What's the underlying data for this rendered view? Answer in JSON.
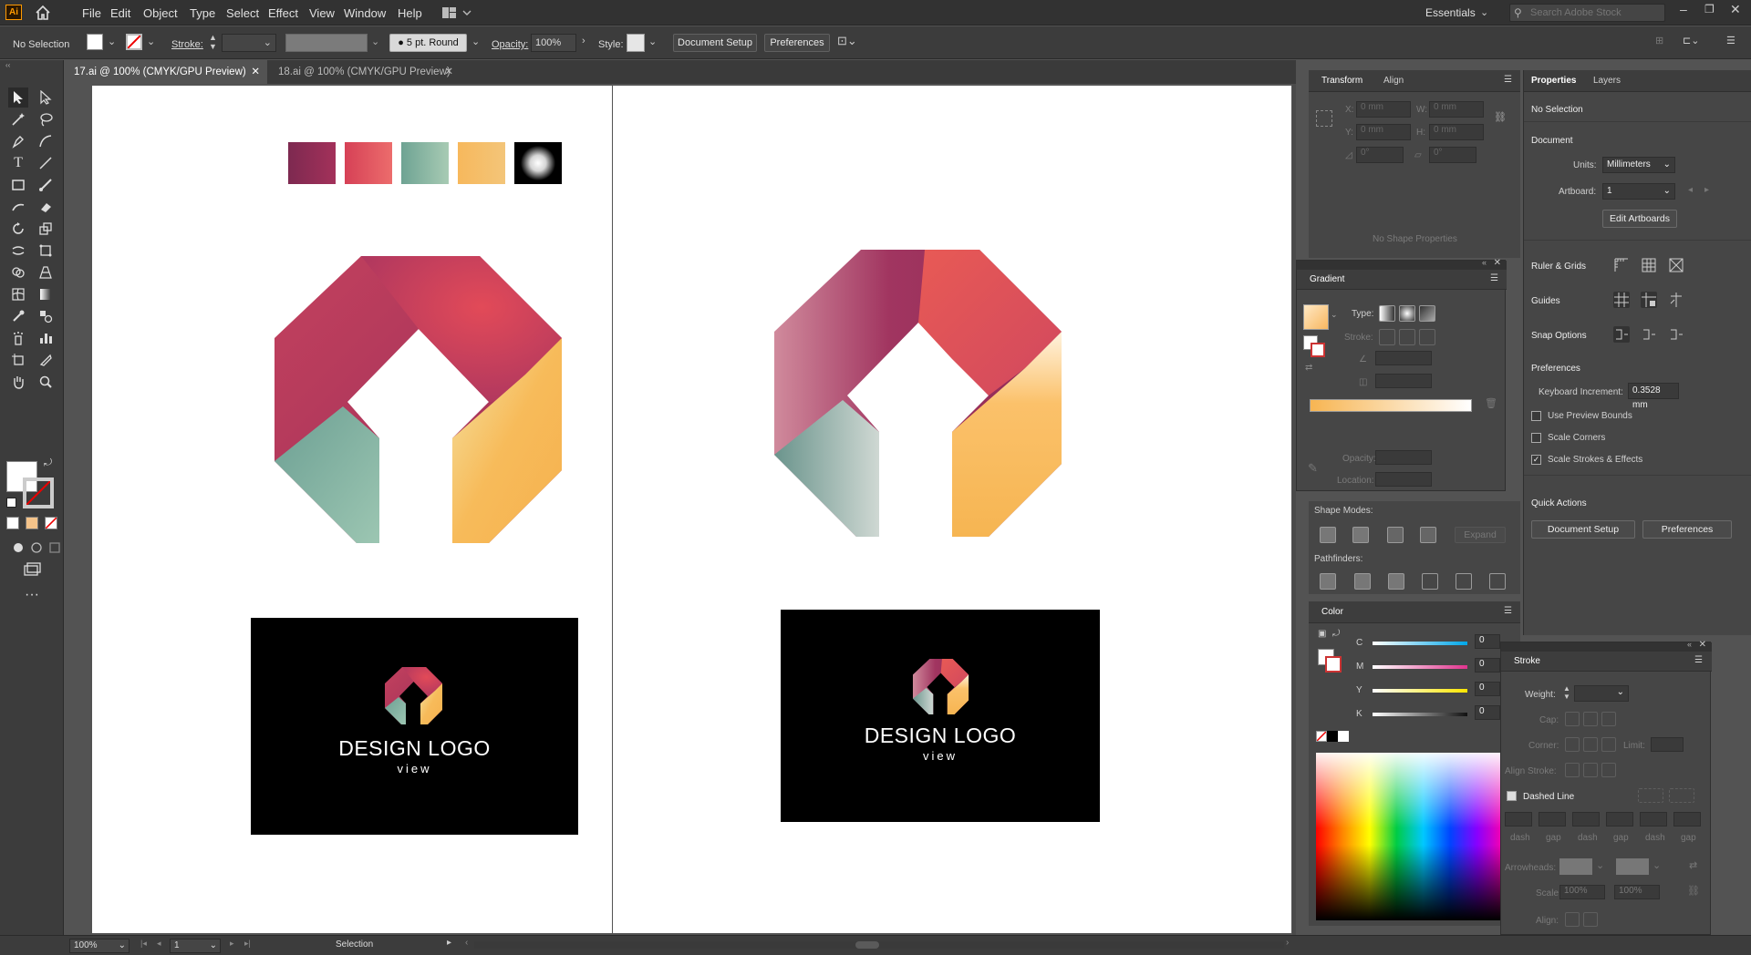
{
  "app": {
    "logo": "Ai",
    "workspace": "Essentials"
  },
  "menu": [
    "File",
    "Edit",
    "Object",
    "Type",
    "Select",
    "Effect",
    "View",
    "Window",
    "Help"
  ],
  "search": {
    "placeholder": "Search Adobe Stock"
  },
  "control_bar": {
    "selection": "No Selection",
    "stroke_label": "Stroke:",
    "brush": "5 pt. Round",
    "opacity_label": "Opacity:",
    "opacity_value": "100%",
    "style_label": "Style:",
    "document_setup": "Document Setup",
    "preferences": "Preferences"
  },
  "tabs": [
    {
      "label": "17.ai @ 100% (CMYK/GPU Preview)",
      "active": true
    },
    {
      "label": "18.ai @ 100% (CMYK/GPU Preview)",
      "active": false
    }
  ],
  "artboards": [
    {
      "swatches": [
        "#8e2a55",
        "#e0505c",
        "#7fb3a6",
        "#f1b860",
        "#000000"
      ],
      "card_title": "DESIGN LOGO",
      "card_subtitle": "view"
    },
    {
      "card_title": "DESIGN LOGO",
      "card_subtitle": "view"
    }
  ],
  "transform_panel": {
    "tabs": [
      "Transform",
      "Align"
    ],
    "x_label": "X:",
    "y_label": "Y:",
    "w_label": "W:",
    "h_label": "H:",
    "x": "0 mm",
    "y": "0 mm",
    "w": "0 mm",
    "h": "0 mm",
    "angle": "0°",
    "shear": "0°",
    "empty": "No Shape Properties"
  },
  "gradient_panel": {
    "title": "Gradient",
    "type_label": "Type:",
    "stroke_label": "Stroke:",
    "opacity_label": "Opacity:",
    "location_label": "Location:"
  },
  "pathfinder_panel": {
    "shape_modes": "Shape Modes:",
    "expand": "Expand",
    "pathfinders": "Pathfinders:"
  },
  "color_panel": {
    "title": "Color",
    "channels": [
      {
        "label": "C",
        "value": "0"
      },
      {
        "label": "M",
        "value": "0"
      },
      {
        "label": "Y",
        "value": "0"
      },
      {
        "label": "K",
        "value": "0"
      }
    ]
  },
  "stroke_panel": {
    "title": "Stroke",
    "weight_label": "Weight:",
    "cap_label": "Cap:",
    "corner_label": "Corner:",
    "limit_label": "Limit:",
    "align_label": "Align Stroke:",
    "dashed_line": "Dashed Line",
    "dash_labels": [
      "dash",
      "gap",
      "dash",
      "gap",
      "dash",
      "gap"
    ],
    "arrowheads_label": "Arrowheads:",
    "scale_label": "Scale:",
    "scale_a": "100%",
    "scale_b": "100%",
    "align2_label": "Align:"
  },
  "properties_panel": {
    "tabs": [
      "Properties",
      "Layers"
    ],
    "selection": "No Selection",
    "document": "Document",
    "units_label": "Units:",
    "units": "Millimeters",
    "artboard_label": "Artboard:",
    "artboard": "1",
    "edit_artboards": "Edit Artboards",
    "ruler_grids": "Ruler & Grids",
    "guides": "Guides",
    "snap_options": "Snap Options",
    "preferences": "Preferences",
    "keyboard_increment_label": "Keyboard Increment:",
    "keyboard_increment": "0.3528 mm",
    "checkboxes": [
      {
        "label": "Use Preview Bounds",
        "checked": false
      },
      {
        "label": "Scale Corners",
        "checked": false
      },
      {
        "label": "Scale Strokes & Effects",
        "checked": true
      }
    ],
    "quick_actions": "Quick Actions",
    "qa_document_setup": "Document Setup",
    "qa_preferences": "Preferences"
  },
  "status_bar": {
    "zoom": "100%",
    "artboard": "1",
    "tool": "Selection"
  }
}
